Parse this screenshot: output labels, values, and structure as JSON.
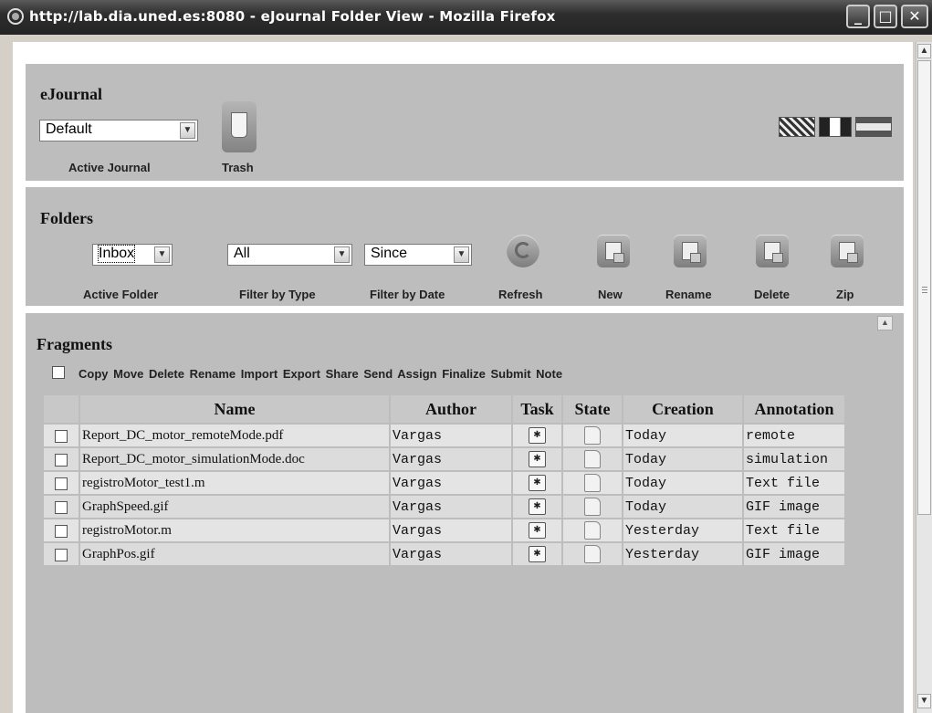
{
  "window": {
    "title": "http://lab.dia.uned.es:8080 - eJournal Folder View - Mozilla Firefox",
    "minimize": "_",
    "maximize": "□",
    "close": "✕"
  },
  "journal": {
    "heading": "eJournal",
    "active_journal_value": "Default",
    "active_journal_caption": "Active Journal",
    "trash_caption": "Trash",
    "languages": [
      "english-flag-icon",
      "french-flag-icon",
      "spanish-flag-icon"
    ]
  },
  "folders": {
    "heading": "Folders",
    "active_folder_value": "Inbox",
    "active_folder_caption": "Active Folder",
    "filter_type_value": "All",
    "filter_type_caption": "Filter by Type",
    "filter_date_value": "Since",
    "filter_date_caption": "Filter by Date",
    "buttons": {
      "refresh": "Refresh",
      "new": "New",
      "rename": "Rename",
      "delete": "Delete",
      "zip": "Zip"
    }
  },
  "fragments": {
    "heading": "Fragments",
    "actions": "Copy Move Delete Rename Import Export Share Send Assign Finalize Submit Note",
    "columns": {
      "name": "Name",
      "author": "Author",
      "task": "Task",
      "state": "State",
      "creation": "Creation",
      "annotation": "Annotation"
    },
    "rows": [
      {
        "name": "Report_DC_motor_remoteMode.pdf",
        "author": "Vargas",
        "creation": "Today",
        "annotation": "remote"
      },
      {
        "name": "Report_DC_motor_simulationMode.doc",
        "author": "Vargas",
        "creation": "Today",
        "annotation": "simulation"
      },
      {
        "name": "registroMotor_test1.m",
        "author": "Vargas",
        "creation": "Today",
        "annotation": "Text file"
      },
      {
        "name": "GraphSpeed.gif",
        "author": "Vargas",
        "creation": "Today",
        "annotation": "GIF image"
      },
      {
        "name": "registroMotor.m",
        "author": "Vargas",
        "creation": "Yesterday",
        "annotation": "Text file"
      },
      {
        "name": "GraphPos.gif",
        "author": "Vargas",
        "creation": "Yesterday",
        "annotation": "GIF image"
      }
    ]
  }
}
